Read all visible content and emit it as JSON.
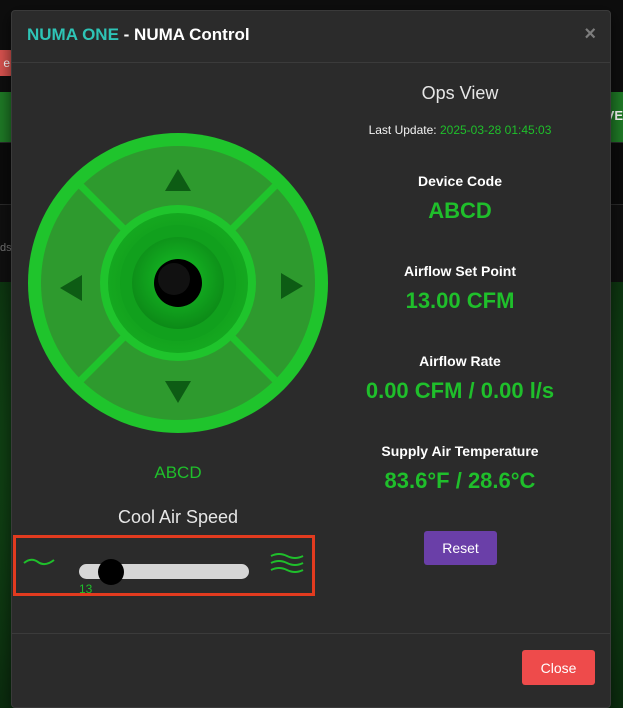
{
  "background": {
    "left_pill_text": "e",
    "right_text": "VE",
    "left_text": "ds"
  },
  "modal": {
    "title_brand": "NUMA ONE",
    "title_rest": " - NUMA Control",
    "close_x": "×"
  },
  "joystick": {
    "device_label": "ABCD",
    "speed_label": "Cool Air Speed",
    "speed_value": "13",
    "speed_fraction": 0.13
  },
  "ops": {
    "title": "Ops View",
    "last_update_label": "Last Update: ",
    "last_update_value": "2025-03-28 01:45:03",
    "device_code_label": "Device Code",
    "device_code_value": "ABCD",
    "setpoint_label": "Airflow Set Point",
    "setpoint_value": "13.00 CFM",
    "rate_label": "Airflow Rate",
    "rate_value": "0.00 CFM / 0.00 l/s",
    "temp_label": "Supply Air Temperature",
    "temp_value": "83.6°F / 28.6°C"
  },
  "buttons": {
    "reset": "Reset",
    "close": "Close"
  },
  "colors": {
    "accent_green": "#1fbf2b",
    "brand_teal": "#2ec4b6",
    "reset_purple": "#6a3fa8",
    "close_red": "#ee4b4b",
    "highlight_red": "#e23b1f"
  }
}
